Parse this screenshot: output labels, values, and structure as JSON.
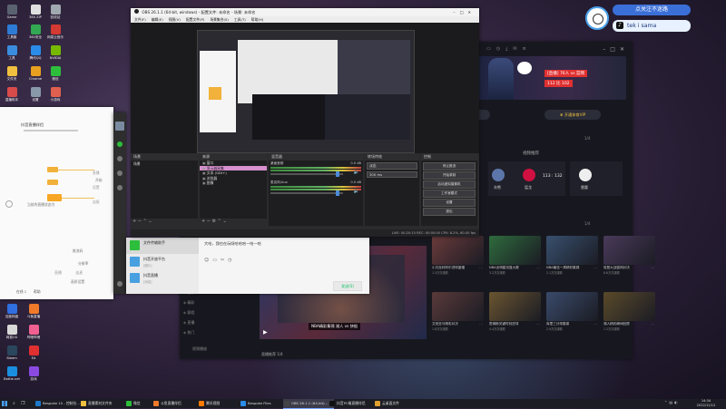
{
  "desktop_icons": [
    {
      "label": "Game",
      "color": "#5a6270"
    },
    {
      "label": "360 ZIP",
      "color": "#e0e0e0"
    },
    {
      "label": "工具箱",
      "color": "#2e7bd6"
    },
    {
      "label": "360安全",
      "color": "#32a852"
    },
    {
      "label": "网易云音乐",
      "color": "#d33a31"
    },
    {
      "label": "工具",
      "color": "#3a8dde"
    },
    {
      "label": "腾讯QQ",
      "color": "#2a8ce8"
    },
    {
      "label": "NVIDIA",
      "color": "#76b900"
    },
    {
      "label": "文件夹",
      "color": "#f0c040"
    },
    {
      "label": "Chrome",
      "color": "#e8a020"
    },
    {
      "label": "微信",
      "color": "#2dbe3c"
    },
    {
      "label": "直播助手",
      "color": "#d84b4b"
    },
    {
      "label": "设置",
      "color": "#8899aa"
    },
    {
      "label": "小游戏",
      "color": "#e06050"
    },
    {
      "label": "回收站",
      "color": "#a0a8b0"
    }
  ],
  "desktop_icons_bottom": [
    {
      "label": "百度网盘",
      "color": "#2f6fe0"
    },
    {
      "label": "斗鱼直播",
      "color": "#f07a2a"
    },
    {
      "label": "网易UU",
      "color": "#d8d8d8"
    },
    {
      "label": "哔哩哔哩",
      "color": "#f06090"
    },
    {
      "label": "Steam",
      "color": "#2a475e"
    },
    {
      "label": "EA",
      "color": "#e03030"
    },
    {
      "label": "Battle.net",
      "color": "#1a8fe0"
    },
    {
      "label": "游戏",
      "color": "#8a4ae0"
    }
  ],
  "overlay": {
    "follow_text": "点关注不迷路",
    "tiktok_label": "tek i sama"
  },
  "obs": {
    "title": "OBS 26.1.1 (64-bit, windows) - 配置文件: 未命名 - 场景: 未命名",
    "menu": [
      "文件(F)",
      "编辑(E)",
      "视图(V)",
      "配置文件(P)",
      "场景集合(S)",
      "工具(T)",
      "帮助(H)"
    ],
    "panels": {
      "scenes": "场景",
      "sources": "来源",
      "mixer": "混音器",
      "transitions": "转场特效",
      "controls": "控制"
    },
    "scene_items": [
      "场景"
    ],
    "source_items": [
      "窗口",
      "显示器采集",
      "文本 (GDI+)",
      "浏览器",
      "图像"
    ],
    "mixer_tracks": [
      {
        "name": "桌面音频",
        "db": "0.0 dB"
      },
      {
        "name": "麦克风/Aux",
        "db": "0.0 dB"
      }
    ],
    "transition": {
      "type": "淡出",
      "duration": "300 ms"
    },
    "control_buttons": [
      "停止推流",
      "开始录制",
      "启动虚拟摄像机",
      "工作室模式",
      "设置",
      "退出"
    ],
    "status": "LIVE: 00:20:15   REC: 00:00:00   CPU: 8.2%, 60.00 fps"
  },
  "flowapp": {
    "title": "抖音直播伴侣",
    "steps": [
      "直播",
      "设置",
      "连接"
    ],
    "labels": [
      "当前的直播状态为",
      "开始",
      "推流码",
      "画质设置",
      "分辨率"
    ],
    "footer": [
      "直播",
      "连麦"
    ],
    "bottom_left": "在线 1",
    "bottom_right": "帮助"
  },
  "wechat": {
    "chats": [
      {
        "name": "文件传输助手",
        "preview": ""
      },
      {
        "name": "抖音开放平台",
        "preview": "[图片]"
      },
      {
        "name": "抖音直播",
        "preview": "[消息]"
      }
    ],
    "message": "大哈，我也在玩呀哈哈哈一哈一哈",
    "send_label": "发送(S)"
  },
  "nba": {
    "player_banner": "[直播] 76人 vs 篮网",
    "player_stat": "112 比 102",
    "vip_left": "开通会员",
    "vip_right": "开通体育VIP",
    "page_left": "1/4",
    "page_right": "1/4",
    "section_left": "赛程",
    "section_right": "视频推荐",
    "games": [
      {
        "home": "灰熊",
        "away": "猛龙",
        "score": "113 : 132",
        "home_color": "#5d76a9",
        "away_color": "#ce1141"
      },
      {
        "home": "奇才",
        "away": "雷霆",
        "score": "",
        "home_color": "#002b5c",
        "away_color": "#007ac1"
      }
    ],
    "sidebar": [
      "关注",
      "推荐",
      "精彩",
      "赛程",
      "直播",
      "热门"
    ],
    "sidebar_bottom": "视频播放",
    "bottom_caption": "直播推荐 1/4",
    "video_rows": [
      [
        {
          "title": "小贝克利阿尔进球盖帽",
          "sub": "1.5万次观看",
          "color": "#6b3b3b"
        },
        {
          "title": "NBA全明星扣篮大赛",
          "sub": "3.2万次观看",
          "color": "#2f6b3d"
        },
        {
          "title": "NBA最佳一周精彩集锦",
          "sub": "2.1万次观看",
          "color": "#38506e"
        },
        {
          "title": "哈登大战篮网对决",
          "sub": "8.6万次观看",
          "color": "#4a3a5a"
        }
      ],
      [
        {
          "title": "文班亚马精彩对决",
          "sub": "1.8万次观看",
          "color": "#5a3a3a"
        },
        {
          "title": "詹姆斯关键时刻进球",
          "sub": "4.4万次观看",
          "color": "#6a5530"
        },
        {
          "title": "库里三分球集锦",
          "sub": "2.9万次观看",
          "color": "#3a4a6a"
        },
        {
          "title": "湖人精彩瞬间回顾",
          "sub": "1.2万次观看",
          "color": "#5a4a2a"
        }
      ]
    ],
    "big_video_caption": "NBA精彩集锦 湖人 vs 快船"
  },
  "taskbar": {
    "items": [
      {
        "label": "Bespoke 10 - 控制台...",
        "color": "#1e78c8"
      },
      {
        "label": "直播素材文件夹",
        "color": "#f0c040"
      },
      {
        "label": "微信",
        "color": "#2dbe3c"
      },
      {
        "label": "斗鱼直播伴侣",
        "color": "#f07a2a"
      },
      {
        "label": "腾讯视频",
        "color": "#ff7a00"
      },
      {
        "label": "Bespoke Files",
        "color": "#2a8ce8"
      },
      {
        "label": "OBS 26.1.1 (64-bit)...",
        "color": "#444",
        "active": true
      },
      {
        "label": "抖音PC端直播伴侣",
        "color": "#111"
      },
      {
        "label": "云桌面文件",
        "color": "#e0a030"
      }
    ],
    "clock_time": "14:34",
    "clock_date": "2022/12/12"
  }
}
